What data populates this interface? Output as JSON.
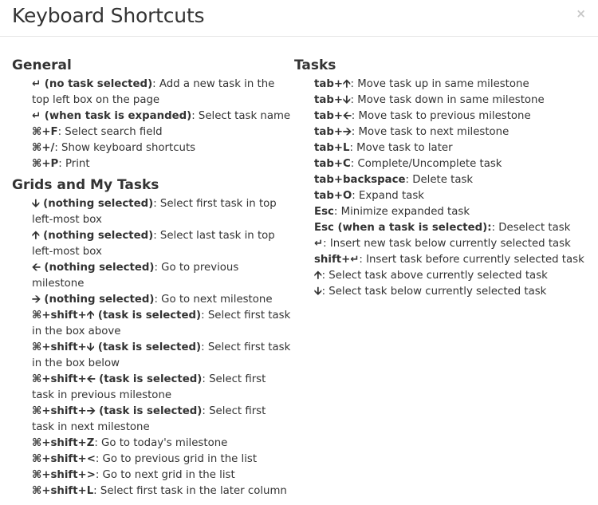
{
  "dialog": {
    "title": "Keyboard Shortcuts",
    "close_label": "×"
  },
  "general": {
    "title": "General",
    "items": [
      {
        "key": "↵ (no task selected)",
        "desc": ": Add a new task in the top left box on the page"
      },
      {
        "key": "↵ (when task is expanded)",
        "desc": ": Select task name"
      },
      {
        "key": "⌘+F",
        "desc": ": Select search field"
      },
      {
        "key": "⌘+/",
        "desc": ": Show keyboard shortcuts"
      },
      {
        "key": "⌘+P",
        "desc": ": Print"
      }
    ]
  },
  "grids": {
    "title": "Grids and My Tasks",
    "items": [
      {
        "key": "🡫 (nothing selected)",
        "desc": ": Select first task in top left-most box"
      },
      {
        "key": "🡩 (nothing selected)",
        "desc": ": Select last task in top left-most box"
      },
      {
        "key": "🡨 (nothing selected)",
        "desc": ": Go to previous milestone"
      },
      {
        "key": "🡪 (nothing selected)",
        "desc": ": Go to next milestone"
      },
      {
        "key": "⌘+shift+🡩 (task is selected)",
        "desc": ": Select first task in the box above"
      },
      {
        "key": "⌘+shift+🡫 (task is selected)",
        "desc": ": Select first task in the box below"
      },
      {
        "key": "⌘+shift+🡨 (task is selected)",
        "desc": ": Select first task in previous milestone"
      },
      {
        "key": "⌘+shift+🡪 (task is selected)",
        "desc": ": Select first task in next milestone"
      },
      {
        "key": "⌘+shift+Z",
        "desc": ": Go to today's milestone"
      },
      {
        "key": "⌘+shift+<",
        "desc": ": Go to previous grid in the list"
      },
      {
        "key": "⌘+shift+>",
        "desc": ": Go to next grid in the list"
      },
      {
        "key": "⌘+shift+L",
        "desc": ": Select first task in the later column"
      }
    ]
  },
  "tasks": {
    "title": "Tasks",
    "items": [
      {
        "key": "tab+🡩",
        "desc": ": Move task up in same milestone"
      },
      {
        "key": "tab+🡫",
        "desc": ": Move task down in same milestone"
      },
      {
        "key": "tab+🡨",
        "desc": ": Move task to previous milestone"
      },
      {
        "key": "tab+🡪",
        "desc": ": Move task to next milestone"
      },
      {
        "key": "tab+L",
        "desc": ": Move task to later"
      },
      {
        "key": "tab+C",
        "desc": ": Complete/Uncomplete task"
      },
      {
        "key": "tab+backspace",
        "desc": ": Delete task"
      },
      {
        "key": "tab+O",
        "desc": ": Expand task"
      },
      {
        "key": "Esc",
        "desc": ": Minimize expanded task"
      },
      {
        "key": "Esc (when a task is selected):",
        "desc": ": Deselect task"
      },
      {
        "key": "↵",
        "desc": ": Insert new task below currently selected task"
      },
      {
        "key": "shift+↵",
        "desc": ": Insert task before currently selected task"
      },
      {
        "key": "🡩",
        "desc": ": Select task above currently selected task"
      },
      {
        "key": "🡫",
        "desc": ": Select task below currently selected task"
      }
    ]
  }
}
